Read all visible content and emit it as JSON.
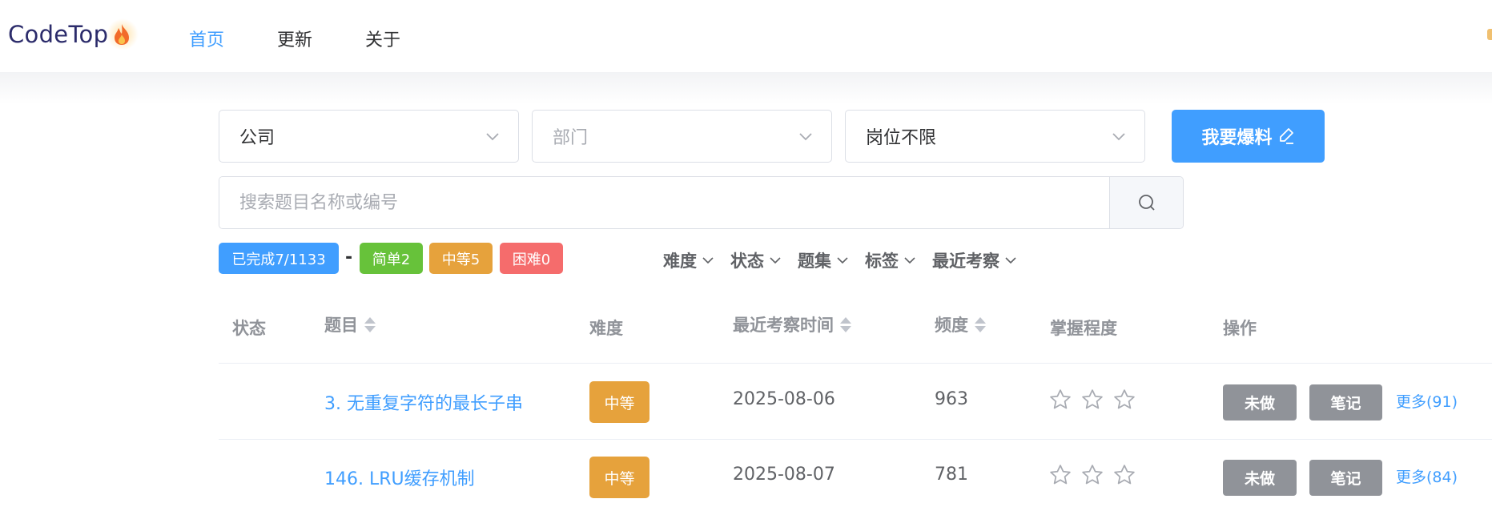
{
  "header": {
    "logo_text": "CodeTop",
    "nav": [
      "首页",
      "更新",
      "关于"
    ]
  },
  "filters": {
    "company_value": "公司",
    "department_placeholder": "部门",
    "position_value": "岗位不限",
    "report_button": "我要爆料"
  },
  "search": {
    "placeholder": "搜索题目名称或编号"
  },
  "stats": {
    "completed": "已完成7/1133",
    "separator": "-",
    "easy": "简单2",
    "medium": "中等5",
    "hard": "困难0"
  },
  "filter_menus": [
    "难度",
    "状态",
    "题集",
    "标签",
    "最近考察"
  ],
  "table": {
    "headers": {
      "status": "状态",
      "title": "题目",
      "difficulty": "难度",
      "last_seen": "最近考察时间",
      "frequency": "频度",
      "mastery": "掌握程度",
      "actions": "操作"
    },
    "rows": [
      {
        "title": "3. 无重复字符的最长子串",
        "difficulty": "中等",
        "date": "2025-08-06",
        "frequency": "963",
        "mastery_stars": 0,
        "todo": "未做",
        "notes": "笔记",
        "more": "更多(91)"
      },
      {
        "title": "146. LRU缓存机制",
        "difficulty": "中等",
        "date": "2025-08-07",
        "frequency": "781",
        "mastery_stars": 0,
        "todo": "未做",
        "notes": "笔记",
        "more": "更多(84)"
      }
    ]
  },
  "colors": {
    "primary": "#409eff",
    "easy": "#67c23a",
    "medium": "#e6a23c",
    "hard": "#f56c6c",
    "gray_button": "#909399"
  }
}
